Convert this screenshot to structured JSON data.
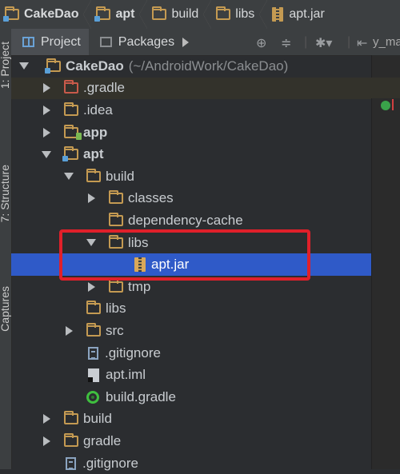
{
  "breadcrumb": [
    "CakeDao",
    "apt",
    "build",
    "libs",
    "apt.jar"
  ],
  "side_tabs": {
    "project": "1: Project",
    "structure": "7: Structure",
    "captures": "Captures"
  },
  "panel": {
    "tabs": [
      "Project",
      "Packages"
    ],
    "editor_tab_label": "y_ma"
  },
  "tree": {
    "root_label": "CakeDao",
    "root_path": "(~/AndroidWork/CakeDao)",
    "gradle": ".gradle",
    "idea": ".idea",
    "app": "app",
    "apt": "apt",
    "build": "build",
    "classes": "classes",
    "dependency_cache": "dependency-cache",
    "libs": "libs",
    "apt_jar": "apt.jar",
    "tmp": "tmp",
    "libs2": "libs",
    "src": "src",
    "gitignore": ".gitignore",
    "apt_iml": "apt.iml",
    "build_gradle": "build.gradle",
    "build_root": "build",
    "gradle_root": "gradle",
    "gitignore_root": ".gitignore"
  },
  "colors": {
    "selection": "#2f5ac8",
    "callout": "#e0202a",
    "folder": "#c49a52"
  }
}
